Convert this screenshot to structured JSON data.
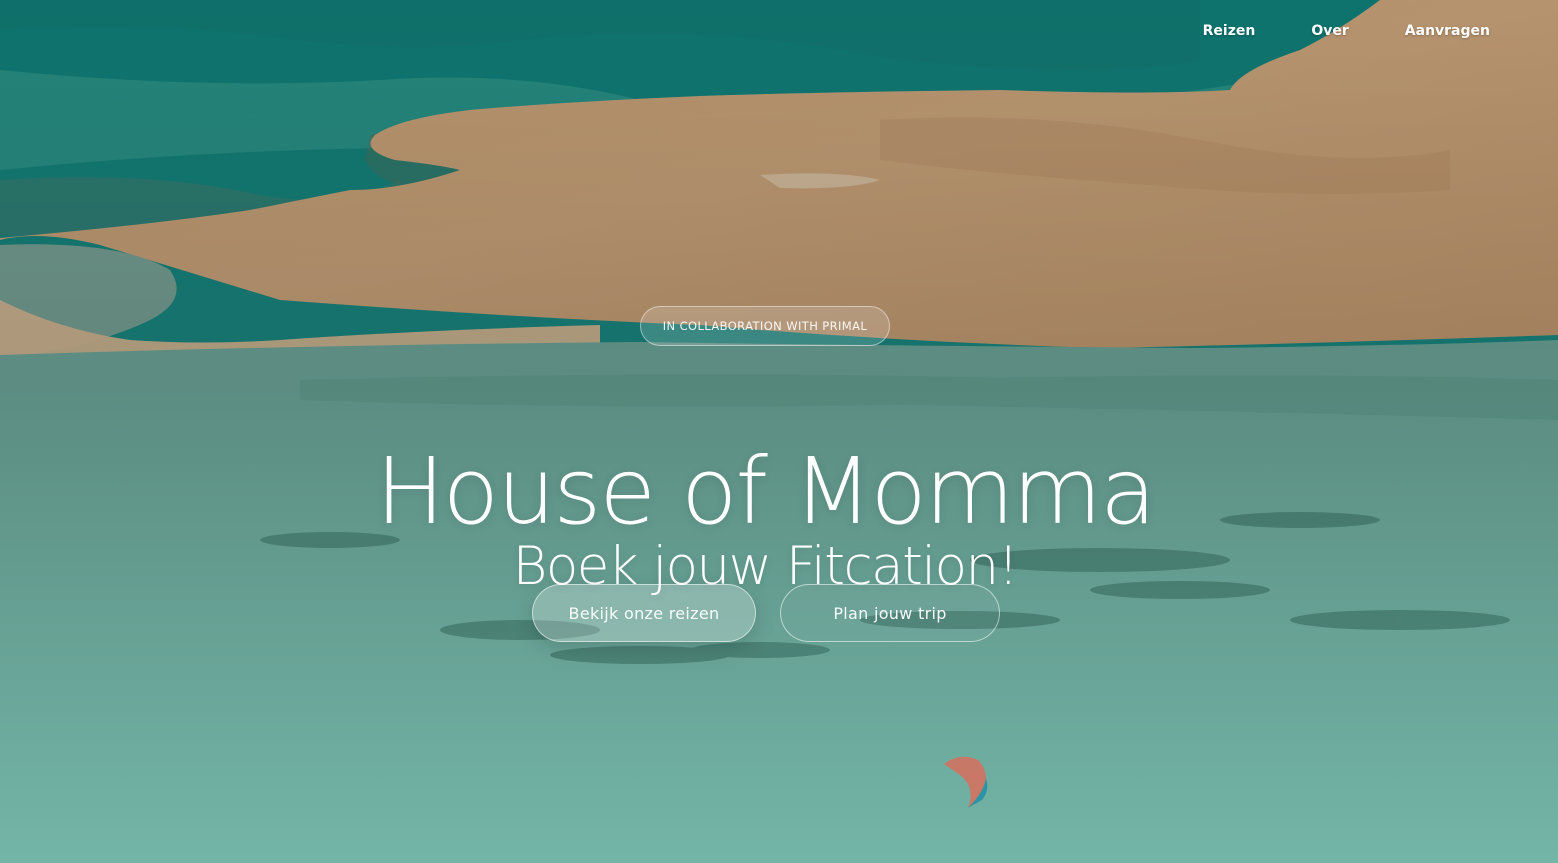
{
  "nav": {
    "items": [
      {
        "label": "Reizen"
      },
      {
        "label": "Over"
      },
      {
        "label": "Aanvragen"
      }
    ]
  },
  "hero": {
    "badge": "IN COLLABORATION WITH PRIMAL",
    "title": "House of Momma",
    "subtitle": "Boek jouw Fitcation!",
    "primary_button": "Bekijk onze reizen",
    "secondary_button": "Plan jouw trip"
  },
  "colors": {
    "lagoon": "#6fb3a6",
    "sea_deep": "#1f8f86",
    "sand": "#c9a276",
    "text": "#ffffff"
  }
}
